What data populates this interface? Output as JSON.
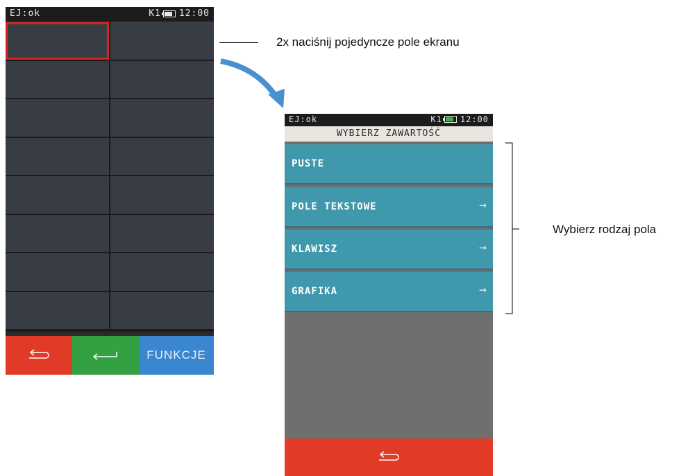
{
  "screen1": {
    "status_left": "EJ:ok",
    "status_right": "K1",
    "time": "12:00",
    "grid_rows": 8,
    "grid_cols": 2,
    "selected_cell": 0,
    "bottom_buttons": [
      {
        "icon": "back-icon",
        "color": "#e13b27"
      },
      {
        "icon": "enter-icon",
        "color": "#33a042"
      },
      {
        "label": "FUNKCJE",
        "color": "#3a86cf"
      }
    ]
  },
  "annotations": {
    "tap_hint": "2x naciśnij pojedyncze pole ekranu",
    "choose_hint": "Wybierz rodzaj pola"
  },
  "screen2": {
    "status_left": "EJ:ok",
    "status_right": "K1",
    "time": "12:00",
    "title": "WYBIERZ ZAWARTOŚĆ",
    "items": [
      {
        "label": "PUSTE",
        "arrow": ""
      },
      {
        "label": "POLE TEKSTOWE",
        "arrow": "→"
      },
      {
        "label": "KLAWISZ",
        "arrow": "→"
      },
      {
        "label": "GRAFIKA",
        "arrow": "→"
      }
    ]
  },
  "colors": {
    "selection": "#d62525",
    "menu_item": "#3f98ab",
    "back_button": "#e13b27",
    "arrow": "#4a8fd0"
  }
}
